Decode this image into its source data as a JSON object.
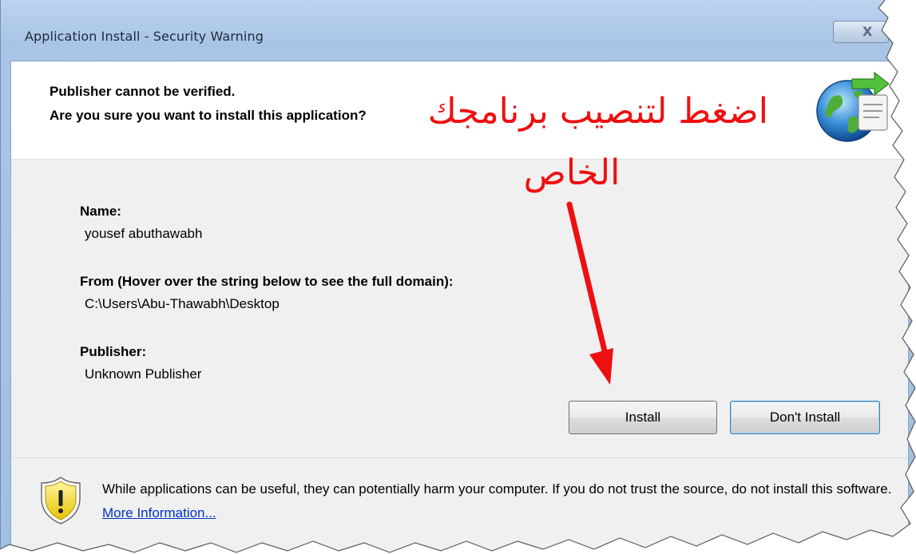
{
  "window": {
    "title": "Application Install - Security Warning",
    "close_glyph": "X"
  },
  "header": {
    "line1": "Publisher cannot be verified.",
    "line2": "Are you sure you want to install this application?"
  },
  "details": {
    "name_label": "Name:",
    "name_value": "yousef abuthawabh",
    "from_label": "From (Hover over the string below to see the full domain):",
    "from_value": "C:\\Users\\Abu-Thawabh\\Desktop",
    "publisher_label": "Publisher:",
    "publisher_value": "Unknown Publisher"
  },
  "buttons": {
    "install": "Install",
    "dont_install": "Don't Install"
  },
  "footer": {
    "warning_text": "While applications can be useful, they can potentially harm your computer. If you do not trust the source, do not install this software.",
    "more_info_link": "More Information..."
  },
  "annotation": {
    "line1": "اضغط لتنصيب برنامجك",
    "line2": "الخاص",
    "color": "#ee1010"
  },
  "icons": {
    "app_icon": "globe-arrow-icon",
    "warning_icon": "shield-warning-icon"
  }
}
